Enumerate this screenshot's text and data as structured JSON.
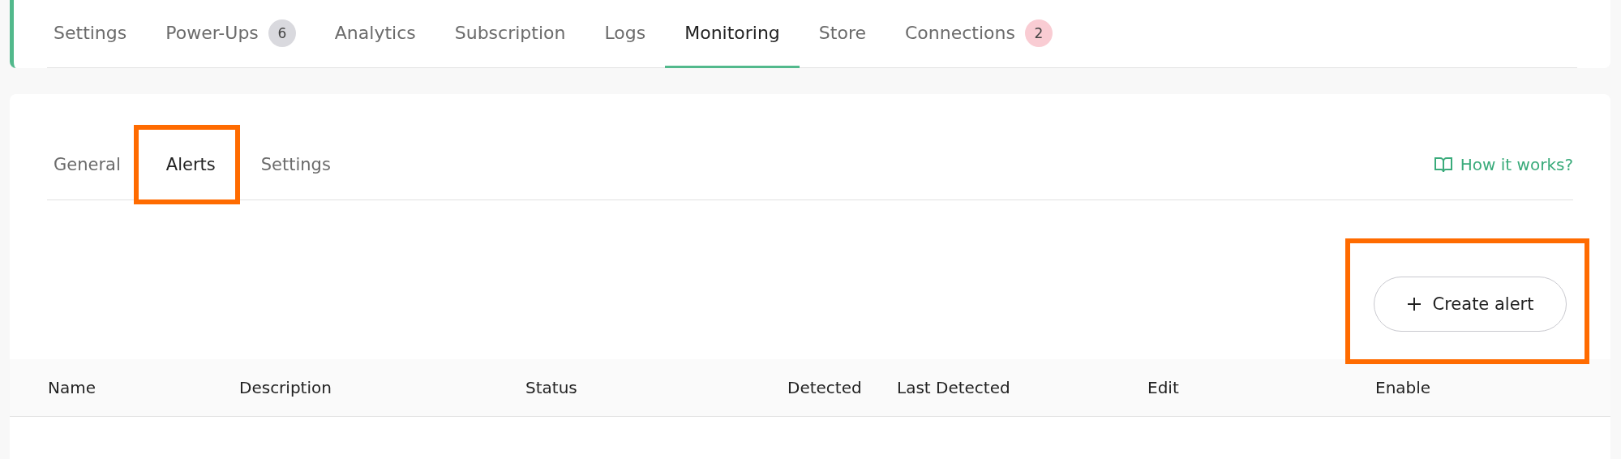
{
  "top_tabs": [
    {
      "label": "Settings",
      "selected": false
    },
    {
      "label": "Power-Ups",
      "selected": false,
      "badge": "6",
      "color": "#d9d9de"
    },
    {
      "label": "Analytics",
      "selected": false
    },
    {
      "label": "Subscription",
      "selected": false
    },
    {
      "label": "Logs",
      "selected": false
    },
    {
      "label": "Monitoring",
      "selected": true
    },
    {
      "label": "Store",
      "selected": false
    },
    {
      "label": "Connections",
      "selected": false,
      "badge": "2",
      "color": "#f9ccd3"
    }
  ],
  "sub_tabs": [
    {
      "label": "General",
      "selected": false,
      "highlighted": false
    },
    {
      "label": "Alerts",
      "selected": true,
      "highlighted": true
    },
    {
      "label": "Settings",
      "selected": false,
      "highlighted": false
    }
  ],
  "help_link": "How it works?",
  "create_button": {
    "label": "Create alert",
    "highlighted": true
  },
  "table": {
    "columns": [
      "Name",
      "Description",
      "Status",
      "Detected",
      "Last Detected",
      "Edit",
      "Enable"
    ]
  }
}
